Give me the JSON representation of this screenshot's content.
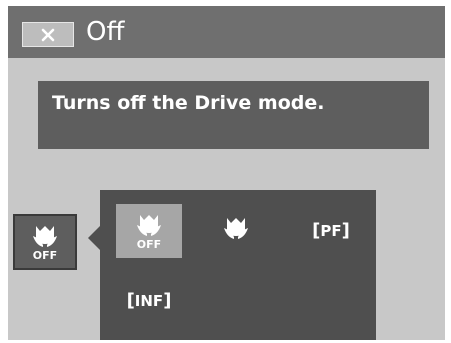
{
  "header": {
    "title": "Off",
    "close_icon": "close-x-icon"
  },
  "description": {
    "text": "Turns off the Drive mode."
  },
  "current_mode": {
    "icon": "macro-flower-icon",
    "label": "OFF"
  },
  "options": [
    {
      "icon": "macro-flower-icon",
      "label": "OFF",
      "selected": true
    },
    {
      "icon": "macro-flower-icon",
      "label": "",
      "selected": false
    },
    {
      "icon": "bracket-focus-icon",
      "label": "PF",
      "selected": false
    },
    {
      "icon": "bracket-focus-icon",
      "label": "INF",
      "selected": false
    }
  ]
}
